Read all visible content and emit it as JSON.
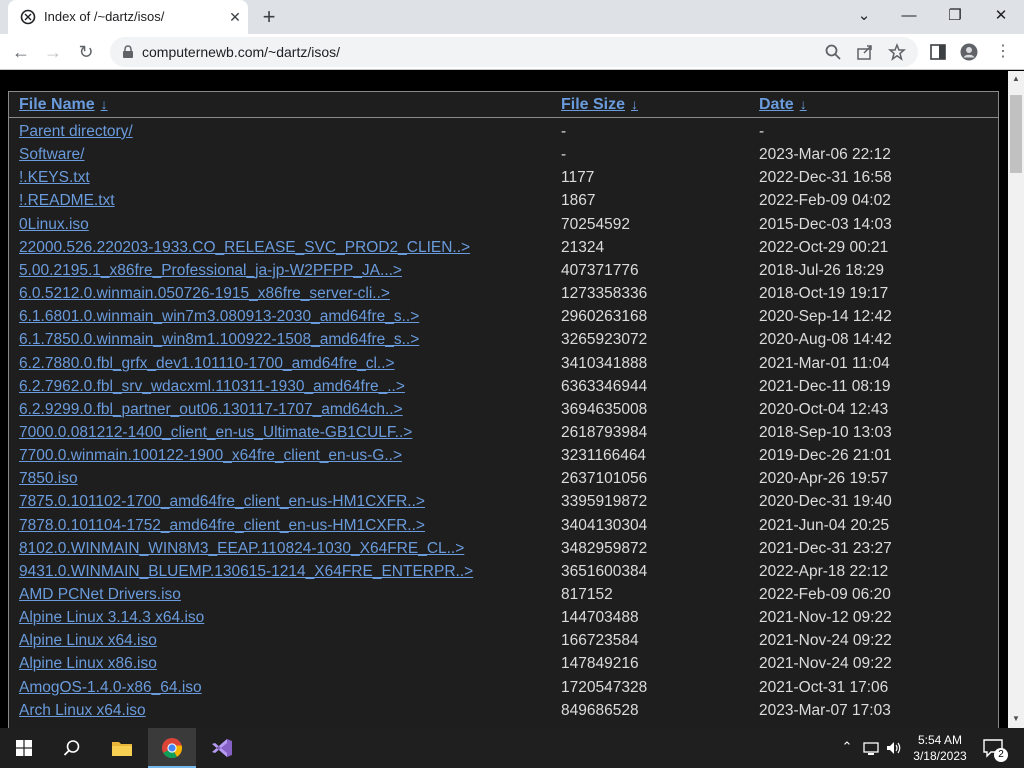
{
  "tab": {
    "title": "Index of /~dartz/isos/"
  },
  "omnibox": {
    "url": "computernewb.com/~dartz/isos/"
  },
  "headers": {
    "name": "File Name",
    "size": "File Size",
    "date": "Date",
    "sort_arrow": "↓"
  },
  "rows": [
    {
      "name": "Parent directory/",
      "size": "-",
      "date": "-"
    },
    {
      "name": "Software/",
      "size": "-",
      "date": "2023-Mar-06 22:12"
    },
    {
      "name": "!.KEYS.txt",
      "size": "1177",
      "date": "2022-Dec-31 16:58"
    },
    {
      "name": "!.README.txt",
      "size": "1867",
      "date": "2022-Feb-09 04:02"
    },
    {
      "name": "0Linux.iso",
      "size": "70254592",
      "date": "2015-Dec-03 14:03"
    },
    {
      "name": "22000.526.220203-1933.CO_RELEASE_SVC_PROD2_CLIEN..>",
      "size": "21324",
      "date": "2022-Oct-29 00:21"
    },
    {
      "name": "5.00.2195.1_x86fre_Professional_ja-jp-W2PFPP_JA...>",
      "size": "407371776",
      "date": "2018-Jul-26 18:29"
    },
    {
      "name": "6.0.5212.0.winmain.050726-1915_x86fre_server-cli..>",
      "size": "1273358336",
      "date": "2018-Oct-19 19:17"
    },
    {
      "name": "6.1.6801.0.winmain_win7m3.080913-2030_amd64fre_s..>",
      "size": "2960263168",
      "date": "2020-Sep-14 12:42"
    },
    {
      "name": "6.1.7850.0.winmain_win8m1.100922-1508_amd64fre_s..>",
      "size": "3265923072",
      "date": "2020-Aug-08 14:42"
    },
    {
      "name": "6.2.7880.0.fbl_grfx_dev1.101110-1700_amd64fre_cl..>",
      "size": "3410341888",
      "date": "2021-Mar-01 11:04"
    },
    {
      "name": "6.2.7962.0.fbl_srv_wdacxml.110311-1930_amd64fre_..>",
      "size": "6363346944",
      "date": "2021-Dec-11 08:19"
    },
    {
      "name": "6.2.9299.0.fbl_partner_out06.130117-1707_amd64ch..>",
      "size": "3694635008",
      "date": "2020-Oct-04 12:43"
    },
    {
      "name": "7000.0.081212-1400_client_en-us_Ultimate-GB1CULF..>",
      "size": "2618793984",
      "date": "2018-Sep-10 13:03"
    },
    {
      "name": "7700.0.winmain.100122-1900_x64fre_client_en-us-G..>",
      "size": "3231166464",
      "date": "2019-Dec-26 21:01"
    },
    {
      "name": "7850.iso",
      "size": "2637101056",
      "date": "2020-Apr-26 19:57"
    },
    {
      "name": "7875.0.101102-1700_amd64fre_client_en-us-HM1CXFR..>",
      "size": "3395919872",
      "date": "2020-Dec-31 19:40"
    },
    {
      "name": "7878.0.101104-1752_amd64fre_client_en-us-HM1CXFR..>",
      "size": "3404130304",
      "date": "2021-Jun-04 20:25"
    },
    {
      "name": "8102.0.WINMAIN_WIN8M3_EEAP.110824-1030_X64FRE_CL..>",
      "size": "3482959872",
      "date": "2021-Dec-31 23:27"
    },
    {
      "name": "9431.0.WINMAIN_BLUEMP.130615-1214_X64FRE_ENTERPR..>",
      "size": "3651600384",
      "date": "2022-Apr-18 22:12"
    },
    {
      "name": "AMD PCNet Drivers.iso",
      "size": "817152",
      "date": "2022-Feb-09 06:20"
    },
    {
      "name": "Alpine Linux 3.14.3 x64.iso",
      "size": "144703488",
      "date": "2021-Nov-12 09:22"
    },
    {
      "name": "Alpine Linux x64.iso",
      "size": "166723584",
      "date": "2021-Nov-24 09:22"
    },
    {
      "name": "Alpine Linux x86.iso",
      "size": "147849216",
      "date": "2021-Nov-24 09:22"
    },
    {
      "name": "AmogOS-1.4.0-x86_64.iso",
      "size": "1720547328",
      "date": "2021-Oct-31 17:06"
    },
    {
      "name": "Arch Linux x64.iso",
      "size": "849686528",
      "date": "2023-Mar-07 17:03"
    }
  ],
  "taskbar": {
    "time": "5:54 AM",
    "date": "3/18/2023",
    "notifications": "2"
  },
  "colors": {
    "link": "#6a9bdc",
    "text": "#dcdcdc",
    "background": "#1e1e1e"
  }
}
